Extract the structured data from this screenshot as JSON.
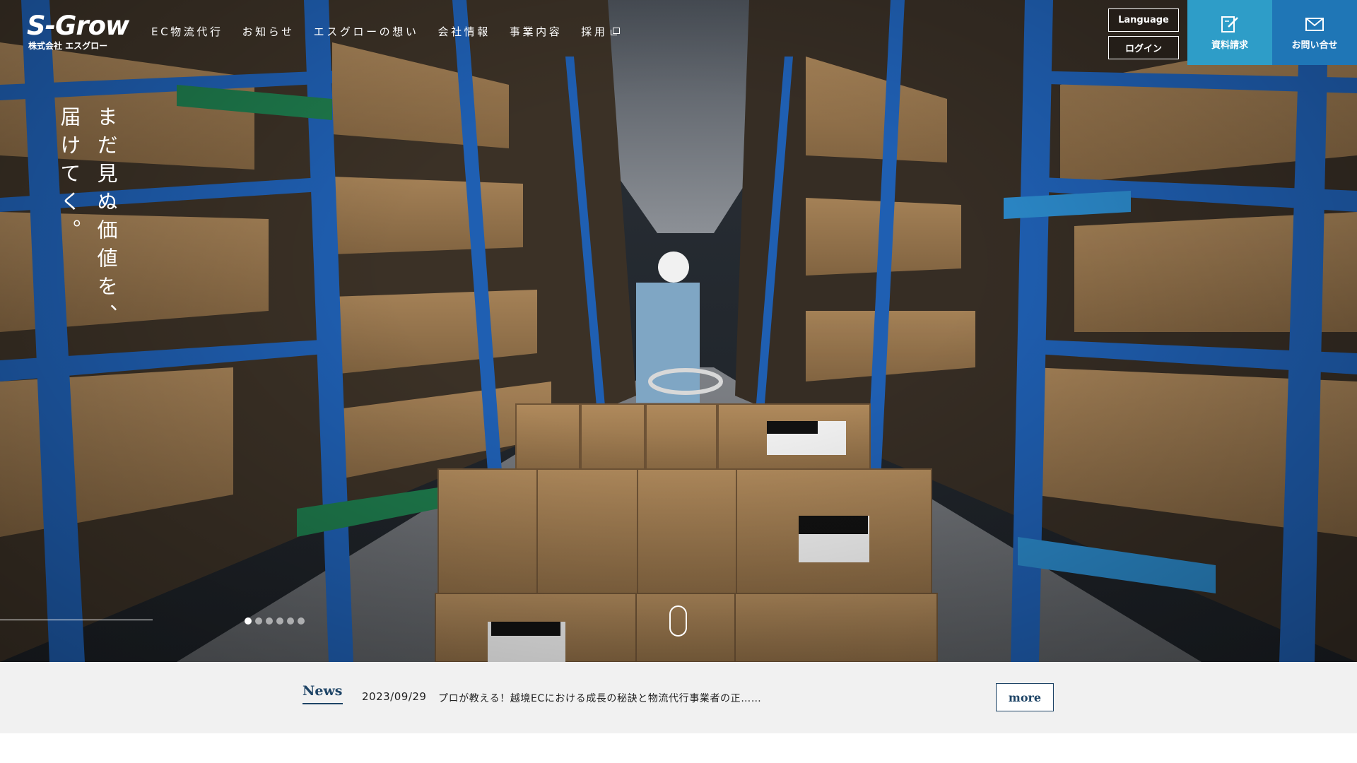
{
  "header": {
    "logo": {
      "main": "S-Grow",
      "sub": "株式会社 エスグロー"
    },
    "nav": [
      {
        "label": "EC物流代行"
      },
      {
        "label": "お知らせ"
      },
      {
        "label": "エスグローの想い"
      },
      {
        "label": "会社情報"
      },
      {
        "label": "事業内容"
      },
      {
        "label": "採用",
        "external": true
      }
    ],
    "language_label": "Language",
    "login_label": "ログイン",
    "cta_document": {
      "label": "資料請求",
      "icon": "document-pencil-icon",
      "color": "#2e9dc8"
    },
    "cta_contact": {
      "label": "お問い合せ",
      "icon": "envelope-icon",
      "color": "#1f76b6"
    }
  },
  "hero": {
    "tagline": "まだ見ぬ価値を、\n届けてく。",
    "slides": {
      "count": 6,
      "active": 1
    }
  },
  "news": {
    "label": "News",
    "date": "2023/09/29",
    "title": "プロが教える！越境ECにおける成長の秘訣と物流代行事業者の正……",
    "more_label": "more",
    "accent_color": "#1e4466"
  }
}
